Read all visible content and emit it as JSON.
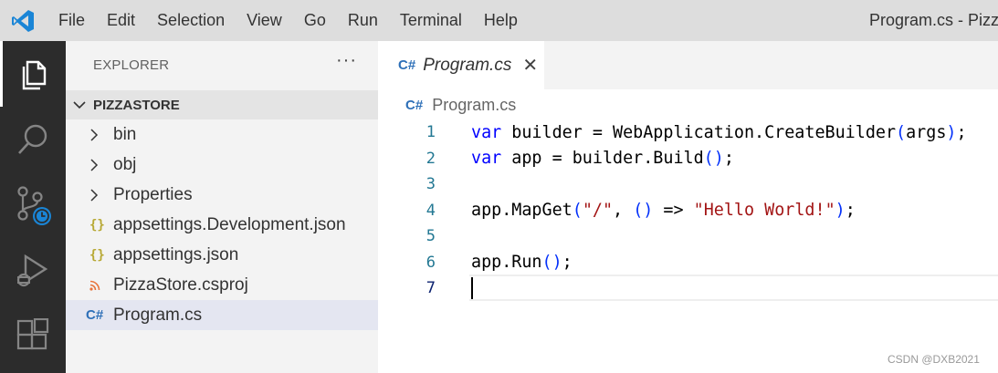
{
  "titlebar": {
    "logo_icon": "vscode-logo-icon",
    "menu": [
      "File",
      "Edit",
      "Selection",
      "View",
      "Go",
      "Run",
      "Terminal",
      "Help"
    ],
    "window_title": "Program.cs - Pizza"
  },
  "activitybar": {
    "items": [
      "explorer-icon",
      "search-icon",
      "source-control-icon",
      "run-debug-icon",
      "extensions-icon"
    ],
    "accent": "#ffffff",
    "background": "#2c2c2c"
  },
  "sidebar": {
    "header": "EXPLORER",
    "more": "···",
    "folder": "PIZZASTORE",
    "items": [
      {
        "label": "bin",
        "icon": "chevron-right-icon"
      },
      {
        "label": "obj",
        "icon": "chevron-right-icon"
      },
      {
        "label": "Properties",
        "icon": "chevron-right-icon"
      },
      {
        "label": "appsettings.Development.json",
        "icon": "json-braces-icon",
        "glyph": "{}"
      },
      {
        "label": "appsettings.json",
        "icon": "json-braces-icon",
        "glyph": "{}"
      },
      {
        "label": "PizzaStore.csproj",
        "icon": "rss-icon",
        "glyph": "))"
      },
      {
        "label": "Program.cs",
        "icon": "csharp-icon",
        "glyph": "C#",
        "selected": true
      }
    ]
  },
  "editor": {
    "tab": {
      "label": "Program.cs",
      "icon_glyph": "C#",
      "close": "✕"
    },
    "breadcrumb": "Program.cs",
    "lines": [
      {
        "n": "1"
      },
      {
        "n": "2"
      },
      {
        "n": "3"
      },
      {
        "n": "4"
      },
      {
        "n": "5"
      },
      {
        "n": "6"
      },
      {
        "n": "7"
      }
    ],
    "code": {
      "l1": {
        "kw": "var",
        "rest": " builder = WebApplication.CreateBuilder",
        "p1": "(",
        "arg": "args",
        "p2": ")",
        "end": ";"
      },
      "l2": {
        "kw": "var",
        "rest": " app = builder.Build",
        "p1": "(",
        "p2": ")",
        "end": ";"
      },
      "l4": {
        "pre": "app.MapGet",
        "p1": "(",
        "s1": "\"/\"",
        "mid": ", ",
        "lp": "(",
        "rp": ")",
        "arrow": " => ",
        "s2": "\"Hello World!\"",
        "p2": ")",
        "end": ";"
      },
      "l6": {
        "pre": "app.Run",
        "p1": "(",
        "p2": ")",
        "end": ";"
      }
    }
  },
  "watermark": "CSDN @DXB2021"
}
